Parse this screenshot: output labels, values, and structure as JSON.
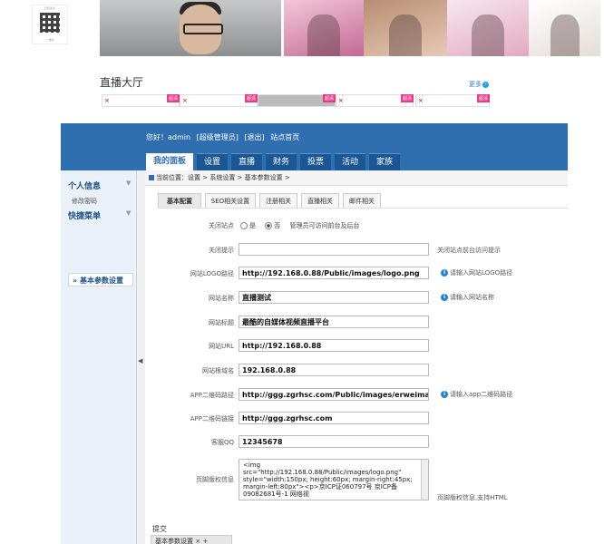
{
  "preview": {
    "qr_caption": "扫码关注",
    "qr_sub": "二维码",
    "hall_title": "直播大厅",
    "more": "更多",
    "card_badge": "超清",
    "card_x": "×"
  },
  "header": {
    "greeting": "您好！admin",
    "role": "[超级管理员]",
    "logout": "[退出]",
    "home": "站点首页",
    "tabs": [
      "我的面板",
      "设置",
      "直播",
      "财务",
      "投票",
      "活动",
      "家族"
    ]
  },
  "sidebar": {
    "section1": "个人信息",
    "section1_item": "修改密码",
    "section2": "快捷菜单",
    "active_item": "基本参数设置"
  },
  "breadcrumb": "当前位置：设置 > 系统设置 > 基本参数设置 >",
  "subtabs": [
    "基本配置",
    "SEO相关设置",
    "注册相关",
    "直播相关",
    "邮件相关"
  ],
  "form": {
    "close_site": {
      "label": "关闭站点",
      "yes": "是",
      "no": "否",
      "note": "管理员可访问前台及后台"
    },
    "close_tip": {
      "label": "关闭提示",
      "value": "",
      "hint": "关闭站点前台访问提示"
    },
    "logo": {
      "label": "网站LOGO路径",
      "value": "http://192.168.0.88/Public/images/logo.png",
      "hint": "请输入网站LOGO路径"
    },
    "name": {
      "label": "网站名称",
      "value": "直播测试",
      "hint": "请输入网站名称"
    },
    "title": {
      "label": "网站标题",
      "value": "最酷的自媒体视频直播平台"
    },
    "url": {
      "label": "网站URL",
      "value": "http://192.168.0.88"
    },
    "domain": {
      "label": "网站根域名",
      "value": "192.168.0.88"
    },
    "app_qr": {
      "label": "APP二维码路径",
      "value": "http://ggg.zgrhsc.com/Public/images/erweima.png",
      "hint": "请输入app二维码路径"
    },
    "app_link": {
      "label": "APP二维码链接",
      "value": "http://ggg.zgrhsc.com"
    },
    "qq": {
      "label": "客服QQ",
      "value": "12345678"
    },
    "footer": {
      "label": "页脚版权信息",
      "value": "<img src=\"http://192.168.0.88/Public/images/logo.png\" style=\"width:150px; height:60px; margin-right:45px; margin-left:80px\"><p>京ICP证060797号 京ICP备09082681号-1 网络视",
      "hint": "页脚版权信息,支持HTML"
    }
  },
  "submit": "提交",
  "bottom_tab": "基本参数设置 × +"
}
